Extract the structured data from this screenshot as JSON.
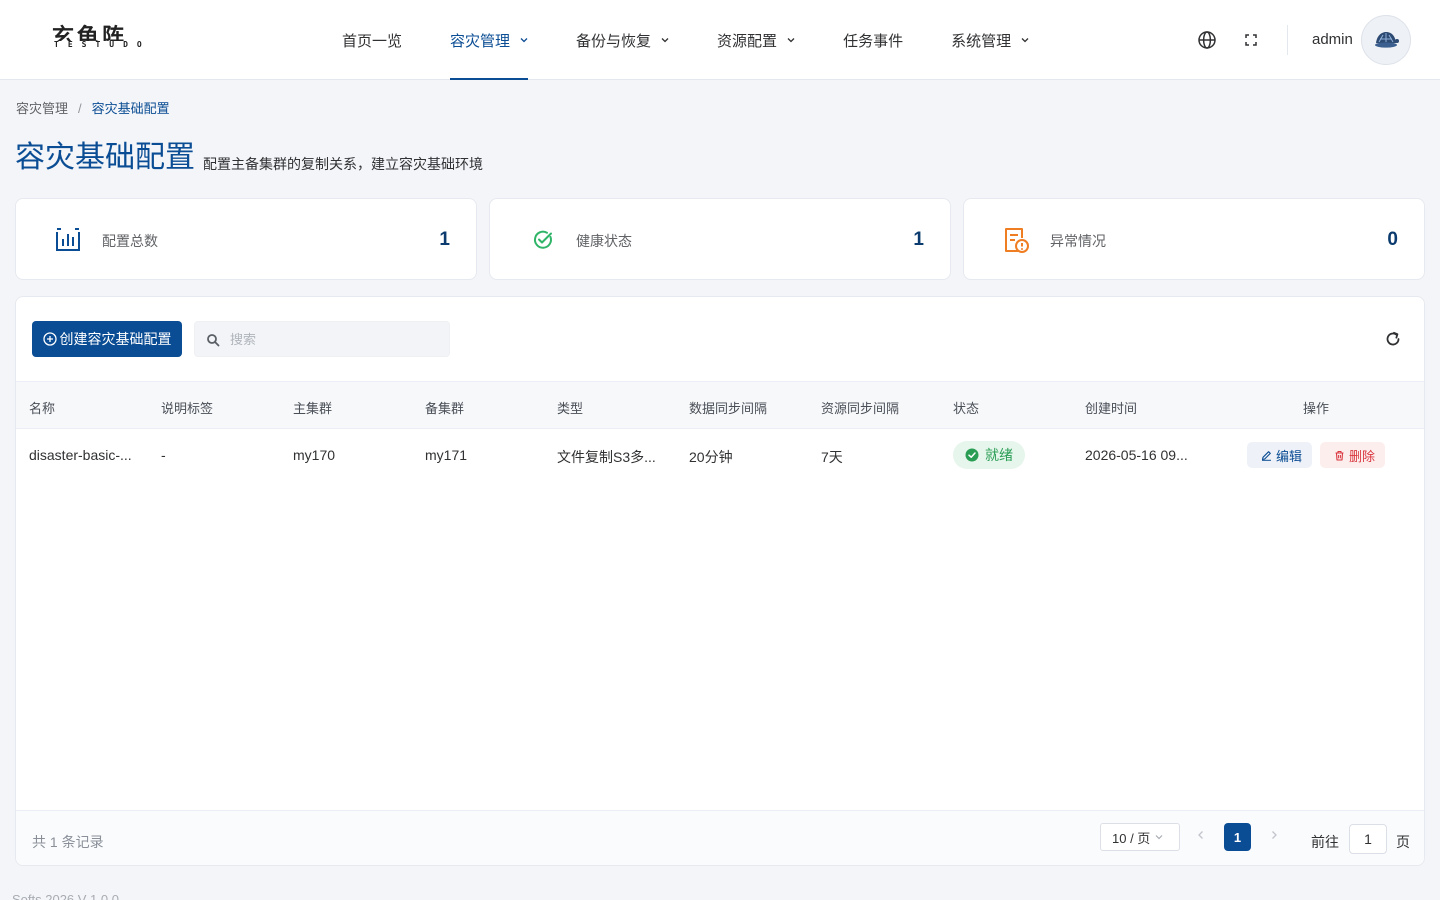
{
  "header": {
    "logo_cn": "玄龟阵",
    "logo_en": "TESTUDO",
    "nav": [
      {
        "label": "首页一览"
      },
      {
        "label": "容灾管理"
      },
      {
        "label": "备份与恢复"
      },
      {
        "label": "资源配置"
      },
      {
        "label": "任务事件"
      },
      {
        "label": "系统管理"
      }
    ],
    "username": "admin"
  },
  "breadcrumb": {
    "parent": "容灾管理",
    "separator": "/",
    "current": "容灾基础配置"
  },
  "page": {
    "title": "容灾基础配置",
    "subtitle": "配置主备集群的复制关系，建立容灾基础环境"
  },
  "stats": [
    {
      "label": "配置总数",
      "value": "1",
      "icon": "bar-chart-icon",
      "color": "#0b4d94"
    },
    {
      "label": "健康状态",
      "value": "1",
      "icon": "check-circle-icon",
      "color": "#2fb468"
    },
    {
      "label": "异常情况",
      "value": "0",
      "icon": "alert-document-icon",
      "color": "#ef7d22"
    }
  ],
  "toolbar": {
    "create_label": "创建容灾基础配置",
    "search_placeholder": "搜索"
  },
  "table": {
    "columns": [
      "名称",
      "说明标签",
      "主集群",
      "备集群",
      "类型",
      "数据同步间隔",
      "资源同步间隔",
      "状态",
      "创建时间",
      "操作"
    ],
    "rows": [
      {
        "name": "disaster-basic-...",
        "tag": "-",
        "primary": "my170",
        "standby": "my171",
        "type": "文件复制S3多...",
        "data_interval": "20分钟",
        "resource_interval": "7天",
        "status": "就绪",
        "created": "2026-05-16 09...",
        "edit_label": "编辑",
        "delete_label": "删除"
      }
    ]
  },
  "pagination": {
    "total_text": "共 1 条记录",
    "page_size": "10 / 页",
    "current_page": "1",
    "goto_label": "前往",
    "goto_value": "1",
    "goto_suffix": "页"
  },
  "footer": {
    "text": "Softs 2026 V 1.0.0"
  },
  "colors": {
    "primary": "#0b4d94",
    "success": "#2a9d55",
    "danger": "#d9363e",
    "warning": "#ef7d22"
  }
}
